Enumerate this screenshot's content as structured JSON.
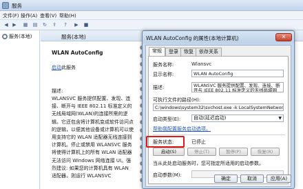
{
  "main": {
    "title": "服务",
    "menu": [
      "文件(F)",
      "操作(A)",
      "查看(V)",
      "帮助(H)"
    ],
    "tree_item": "服务(本地)",
    "header": "服务(本地)",
    "service_name": "WLAN AutoConfig",
    "link": "启动",
    "link_suffix": "此服务",
    "desc_label": "描述:",
    "desc_text": "WLANSVC 服务提供配置、发现、连接、断开与 IEEE 802.11 标准定义的无线局域网(WLAN)的连接所需的逻辑。它还包含将计算机变成软件访问点的逻辑，以便其他设备或计算机可以使用支持它的 WLAN 适配器无线连接到计算机。停止或禁用 WLANSVC 服务将使得计算机上的所有 WLAN 适配器无法访问 Windows 网络连接 UI。强烈建议: 如果您的计算机具有 WLAN 适配器，则运行 WLANSVC"
  },
  "dialog": {
    "title": "WLAN AutoConfig 的属性(本地计算机)",
    "close": "✕",
    "tabs": [
      "常规",
      "登录",
      "恢复",
      "依存关系"
    ],
    "service_name_label": "服务名称:",
    "service_name_value": "Wlansvc",
    "display_name_label": "显示名称:",
    "display_name_value": "WLAN AutoConfig",
    "desc_label": "描述:",
    "desc_value": "WLANSVC 服务提供配置、发现、连接、断开与 IEEE 802.11 标准定义的无线局域网(WLAN)的",
    "exe_label": "可执行文件的路径(H):",
    "exe_value": "C:\\windows\\system32\\svchost.exe -k LocalSystemNetworkRestricted",
    "startup_label": "启动类型(E):",
    "startup_value": "自动(延迟启动)",
    "help_link": "帮助我配置服务启动选项。",
    "status_label": "服务状态:",
    "status_value": "已停止",
    "buttons": [
      "启动(S)",
      "停止(T)",
      "暂停(P)",
      "恢复(R)"
    ],
    "hint": "当从此处启动服务时，您可指定所适用的启动参数。",
    "param_label": "启动参数(M):",
    "footer_buttons": [
      "确定",
      "取消",
      "应用(A)"
    ]
  }
}
